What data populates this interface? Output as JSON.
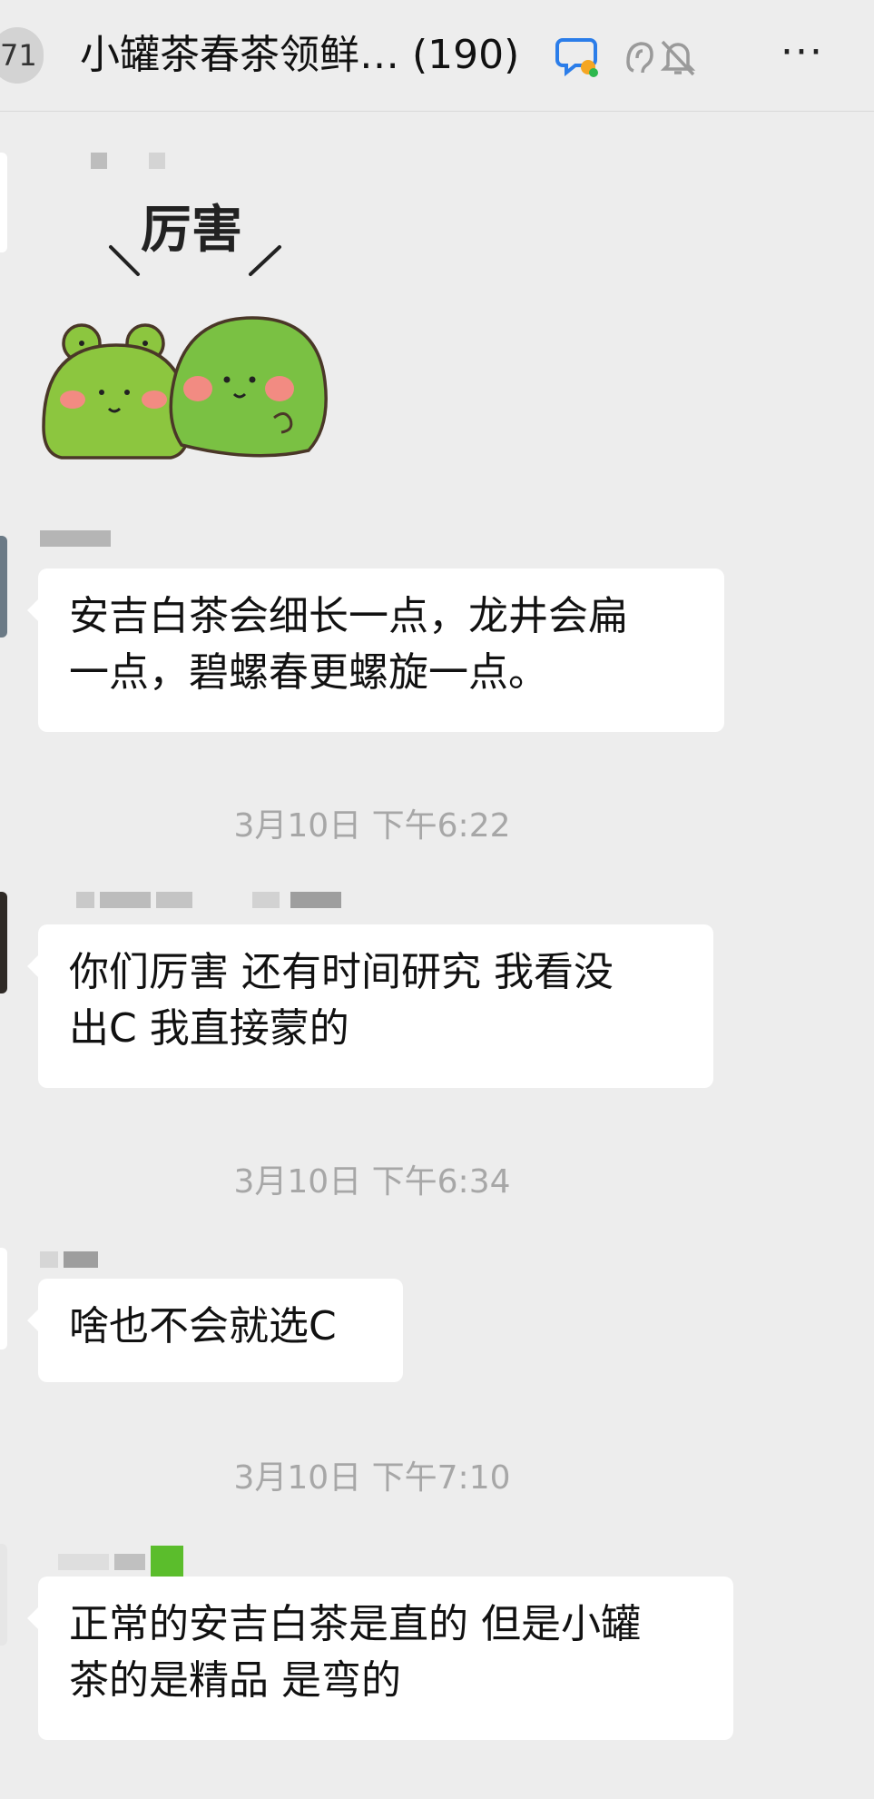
{
  "header": {
    "back_count": "71",
    "title": "小罐茶春茶领鲜…  (190)",
    "more_label": "···"
  },
  "sticker": {
    "text": "厉害"
  },
  "messages": [
    {
      "text_line1": "安吉白茶会细长一点，龙井会扁",
      "text_line2": "一点，碧螺春更螺旋一点。"
    },
    {
      "time": "3月10日 下午6:22",
      "text_line1": "你们厉害 还有时间研究  我看没",
      "text_line2": "出C 我直接蒙的"
    },
    {
      "time": "3月10日 下午6:34",
      "text_line1": "啥也不会就选C"
    },
    {
      "time": "3月10日 下午7:10",
      "text_line1": "正常的安吉白茶是直的 但是小罐",
      "text_line2": "茶的是精品 是弯的"
    }
  ],
  "colors": {
    "background": "#ededed",
    "bubble": "#ffffff",
    "timestamp": "#a7a7a7",
    "frog_green": "#8cc63f",
    "turtle_green": "#7ac143",
    "cheek_pink": "#f28b82"
  }
}
